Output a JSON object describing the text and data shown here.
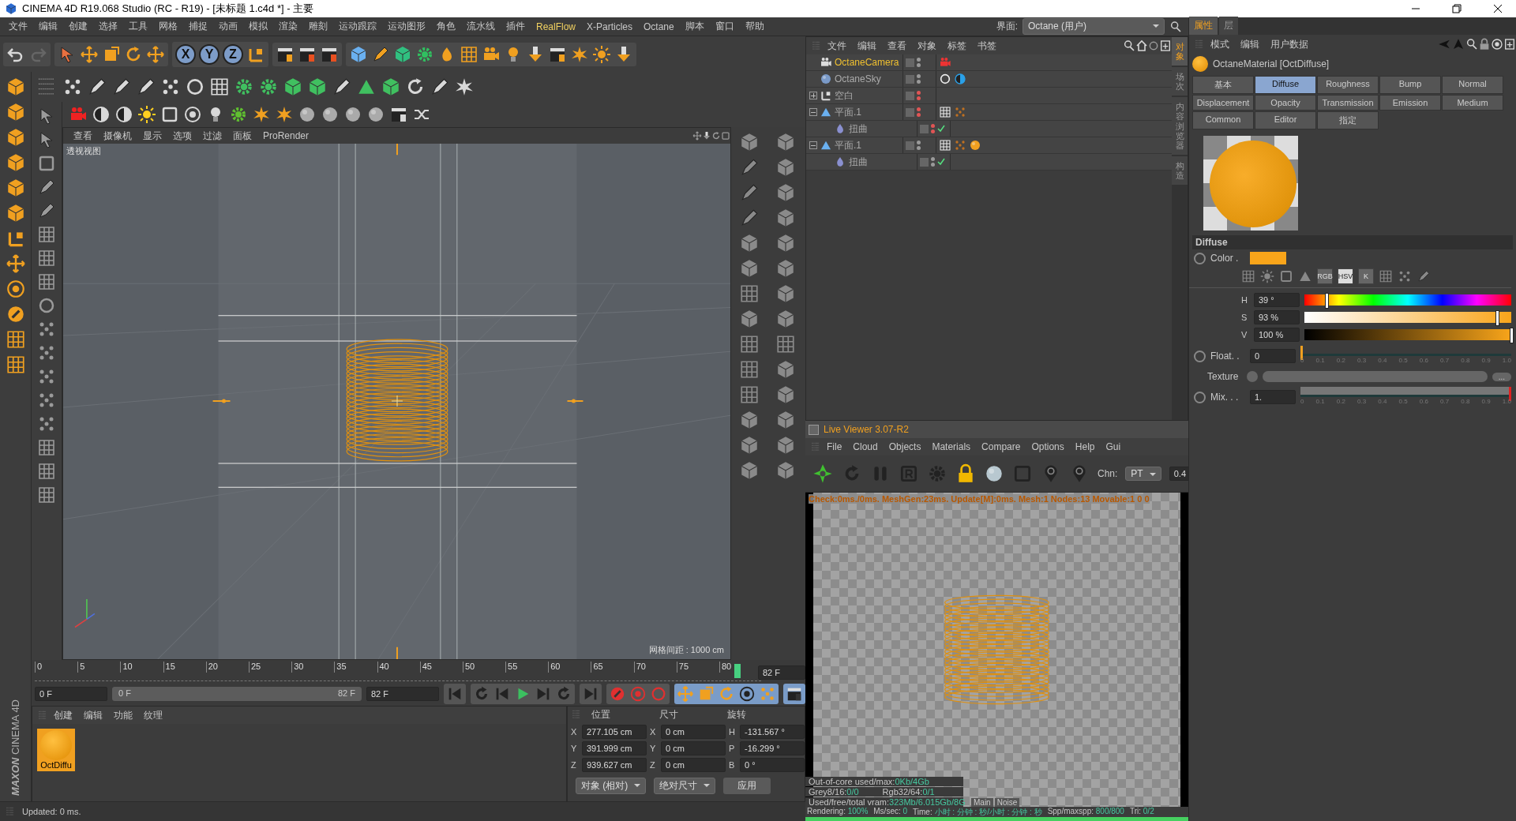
{
  "window": {
    "title": "CINEMA 4D R19.068 Studio (RC - R19) - [未标题 1.c4d *] - 主要"
  },
  "menu": [
    {
      "label": "文件",
      "highlighted": false
    },
    {
      "label": "编辑",
      "highlighted": false
    },
    {
      "label": "创建",
      "highlighted": false
    },
    {
      "label": "选择",
      "highlighted": false
    },
    {
      "label": "工具",
      "highlighted": false
    },
    {
      "label": "网格",
      "highlighted": false
    },
    {
      "label": "捕捉",
      "highlighted": false
    },
    {
      "label": "动画",
      "highlighted": false
    },
    {
      "label": "模拟",
      "highlighted": false
    },
    {
      "label": "渲染",
      "highlighted": false
    },
    {
      "label": "雕刻",
      "highlighted": false
    },
    {
      "label": "运动跟踪",
      "highlighted": false
    },
    {
      "label": "运动图形",
      "highlighted": false
    },
    {
      "label": "角色",
      "highlighted": false
    },
    {
      "label": "流水线",
      "highlighted": false
    },
    {
      "label": "插件",
      "highlighted": false
    },
    {
      "label": "RealFlow",
      "highlighted": true
    },
    {
      "label": "X-Particles",
      "highlighted": false
    },
    {
      "label": "Octane",
      "highlighted": false
    },
    {
      "label": "脚本",
      "highlighted": false
    },
    {
      "label": "窗口",
      "highlighted": false
    },
    {
      "label": "帮助",
      "highlighted": false
    }
  ],
  "interface": {
    "label": "界面:",
    "value": "Octane (用户)"
  },
  "axis_buttons": [
    "X",
    "Y",
    "Z"
  ],
  "viewport": {
    "menu": [
      "查看",
      "摄像机",
      "显示",
      "选项",
      "过滤",
      "面板",
      "ProRender"
    ],
    "view_name": "透视视图",
    "grid_spacing": "网格间距 : 1000 cm"
  },
  "timeline": {
    "ticks": [
      "0",
      "5",
      "10",
      "15",
      "20",
      "25",
      "30",
      "35",
      "40",
      "45",
      "50",
      "55",
      "60",
      "65",
      "70",
      "75",
      "80"
    ],
    "current_frame": "82 F"
  },
  "playback": {
    "level": 1,
    "start": "0 F",
    "range_start": "0 F",
    "range_end": "82 F",
    "end": "82 F"
  },
  "materials": {
    "menu": [
      "创建",
      "编辑",
      "功能",
      "纹理"
    ],
    "items": [
      {
        "name": "OctDiffu",
        "selected": true
      }
    ]
  },
  "coordinates": {
    "headers": [
      "位置",
      "尺寸",
      "旋转"
    ],
    "rows": [
      [
        {
          "axis": "X",
          "value": "277.105 cm"
        },
        {
          "axis": "X",
          "value": "0 cm"
        },
        {
          "axis": "H",
          "value": "-131.567 °"
        }
      ],
      [
        {
          "axis": "Y",
          "value": "391.999 cm"
        },
        {
          "axis": "Y",
          "value": "0 cm"
        },
        {
          "axis": "P",
          "value": "-16.299 °"
        }
      ],
      [
        {
          "axis": "Z",
          "value": "939.627 cm"
        },
        {
          "axis": "Z",
          "value": "0 cm"
        },
        {
          "axis": "B",
          "value": "0 °"
        }
      ]
    ],
    "dropdowns": [
      "对象 (相对)",
      "绝对尺寸"
    ],
    "apply": "应用"
  },
  "brand": {
    "company": "MAXON",
    "product": "CINEMA 4D"
  },
  "status_bar": "Updated: 0 ms.",
  "objects": {
    "menu": [
      "文件",
      "编辑",
      "查看",
      "对象",
      "标签",
      "书签"
    ],
    "items": [
      {
        "name": "OctaneCamera",
        "kind": "camera",
        "selected": true,
        "color": "#9a9a9a",
        "checked": false,
        "tags": [
          {
            "kind": "camera"
          }
        ]
      },
      {
        "name": "OctaneSky",
        "kind": "sky",
        "selected": false,
        "color": "#9a9a9a",
        "checked": false,
        "tags": [
          {
            "kind": "sky"
          },
          {
            "kind": "contrast"
          }
        ]
      },
      {
        "name": "空白",
        "kind": "null",
        "selected": false,
        "color": "#e05555",
        "checked": false,
        "expanded": false
      },
      {
        "name": "平面.1",
        "kind": "plane",
        "selected": false,
        "color": "#e05555",
        "checked": false,
        "expanded": true,
        "tags": [
          {
            "kind": "texture"
          },
          {
            "kind": "dots"
          }
        ],
        "children": [
          {
            "name": "扭曲",
            "kind": "deformer",
            "selected": false,
            "color": "#e05555",
            "checked": true
          }
        ]
      },
      {
        "name": "平面.1",
        "kind": "plane",
        "selected": false,
        "color": "#9a9a9a",
        "checked": false,
        "expanded": true,
        "tags": [
          {
            "kind": "texture"
          },
          {
            "kind": "dots"
          },
          {
            "kind": "material"
          }
        ],
        "children": [
          {
            "name": "扭曲",
            "kind": "deformer",
            "selected": false,
            "color": "#9a9a9a",
            "checked": true
          }
        ]
      }
    ]
  },
  "side_tabs": [
    {
      "label": "对象",
      "selected": true
    },
    {
      "label": "场次",
      "selected": false
    },
    {
      "label": "内容浏览器",
      "selected": false
    },
    {
      "label": "构造",
      "selected": false
    }
  ],
  "live_viewer": {
    "checked": false,
    "title": "Live Viewer 3.07-R2",
    "menu": [
      "File",
      "Cloud",
      "Objects",
      "Materials",
      "Compare",
      "Options",
      "Help",
      "Gui"
    ],
    "channel_label": "Chn:",
    "channel": "PT",
    "value": "0.4",
    "info": "Check:0ms./0ms. MeshGen:23ms. Update[M]:0ms. Mesh:1 Nodes:13 Movable:1  0 0",
    "stats": [
      [
        {
          "label": "Out-of-core used/max:",
          "value": "0Kb/4Gb"
        }
      ],
      [
        {
          "label": "Grey8/16:",
          "value": "0/0"
        },
        {
          "label": "Rgb32/64:",
          "value": "0/1"
        }
      ],
      [
        {
          "label": "Used/free/total vram:",
          "value": "323Mb/6.015Gb/8G"
        }
      ]
    ],
    "buttons": [
      "Main",
      "Noise"
    ],
    "status": [
      {
        "label": "Rendering:",
        "value": "100%"
      },
      {
        "label": "Ms/sec:",
        "value": "0"
      },
      {
        "label": "Time:",
        "value": "小时 : 分钟 : 秒/小时 : 分钟 : 秒"
      },
      {
        "label": "Spp/maxspp:",
        "value": "800/800"
      },
      {
        "label": "Tri:",
        "value": "0/2"
      }
    ],
    "level": 1
  },
  "attributes": {
    "tabs": [
      {
        "label": "属性",
        "selected": true
      },
      {
        "label": "层",
        "selected": false
      }
    ],
    "menu": [
      "模式",
      "编辑",
      "用户数据"
    ],
    "title": "OctaneMaterial [OctDiffuse]",
    "channel_tabs": [
      {
        "label": "基本",
        "selected": false
      },
      {
        "label": "Diffuse",
        "selected": true
      },
      {
        "label": "Roughness",
        "selected": false
      },
      {
        "label": "Bump",
        "selected": false
      },
      {
        "label": "Normal",
        "selected": false
      },
      {
        "label": "Displacement",
        "selected": false
      },
      {
        "label": "Opacity",
        "selected": false
      },
      {
        "label": "Transmission",
        "selected": false
      },
      {
        "label": "Emission",
        "selected": false
      },
      {
        "label": "Medium",
        "selected": false
      },
      {
        "label": "Common",
        "selected": false
      },
      {
        "label": "Editor",
        "selected": false
      },
      {
        "label": "指定",
        "selected": false
      }
    ],
    "section": "Diffuse",
    "color_on": false,
    "color_label": "Color .",
    "color": "#f9a51a",
    "modes": [
      {
        "label": "RGB",
        "selected": false
      },
      {
        "label": "HSV",
        "selected": true
      },
      {
        "label": "K",
        "selected": false
      }
    ],
    "hsv": [
      {
        "kind": "hue",
        "label": "H",
        "value": "39 °",
        "level": 0.108
      },
      {
        "kind": "saturation",
        "label": "S",
        "value": "93 %",
        "level": 0.93
      },
      {
        "kind": "value",
        "label": "V",
        "value": "100 %",
        "level": 1
      }
    ],
    "float": {
      "on": false,
      "label": "Float. .",
      "value": "0",
      "level": 0,
      "ticks": [
        "0",
        "0.1",
        "0.2",
        "0.3",
        "0.4",
        "0.5",
        "0.6",
        "0.7",
        "0.8",
        "0.9",
        "1.0"
      ]
    },
    "texture": {
      "label": "Texture",
      "button": "..."
    },
    "mix": {
      "on": false,
      "label": "Mix. . .",
      "value": "1.",
      "level": 1,
      "ticks": [
        "0",
        "0.1",
        "0.2",
        "0.3",
        "0.4",
        "0.5",
        "0.6",
        "0.7",
        "0.8",
        "0.9",
        "1.0"
      ]
    }
  }
}
